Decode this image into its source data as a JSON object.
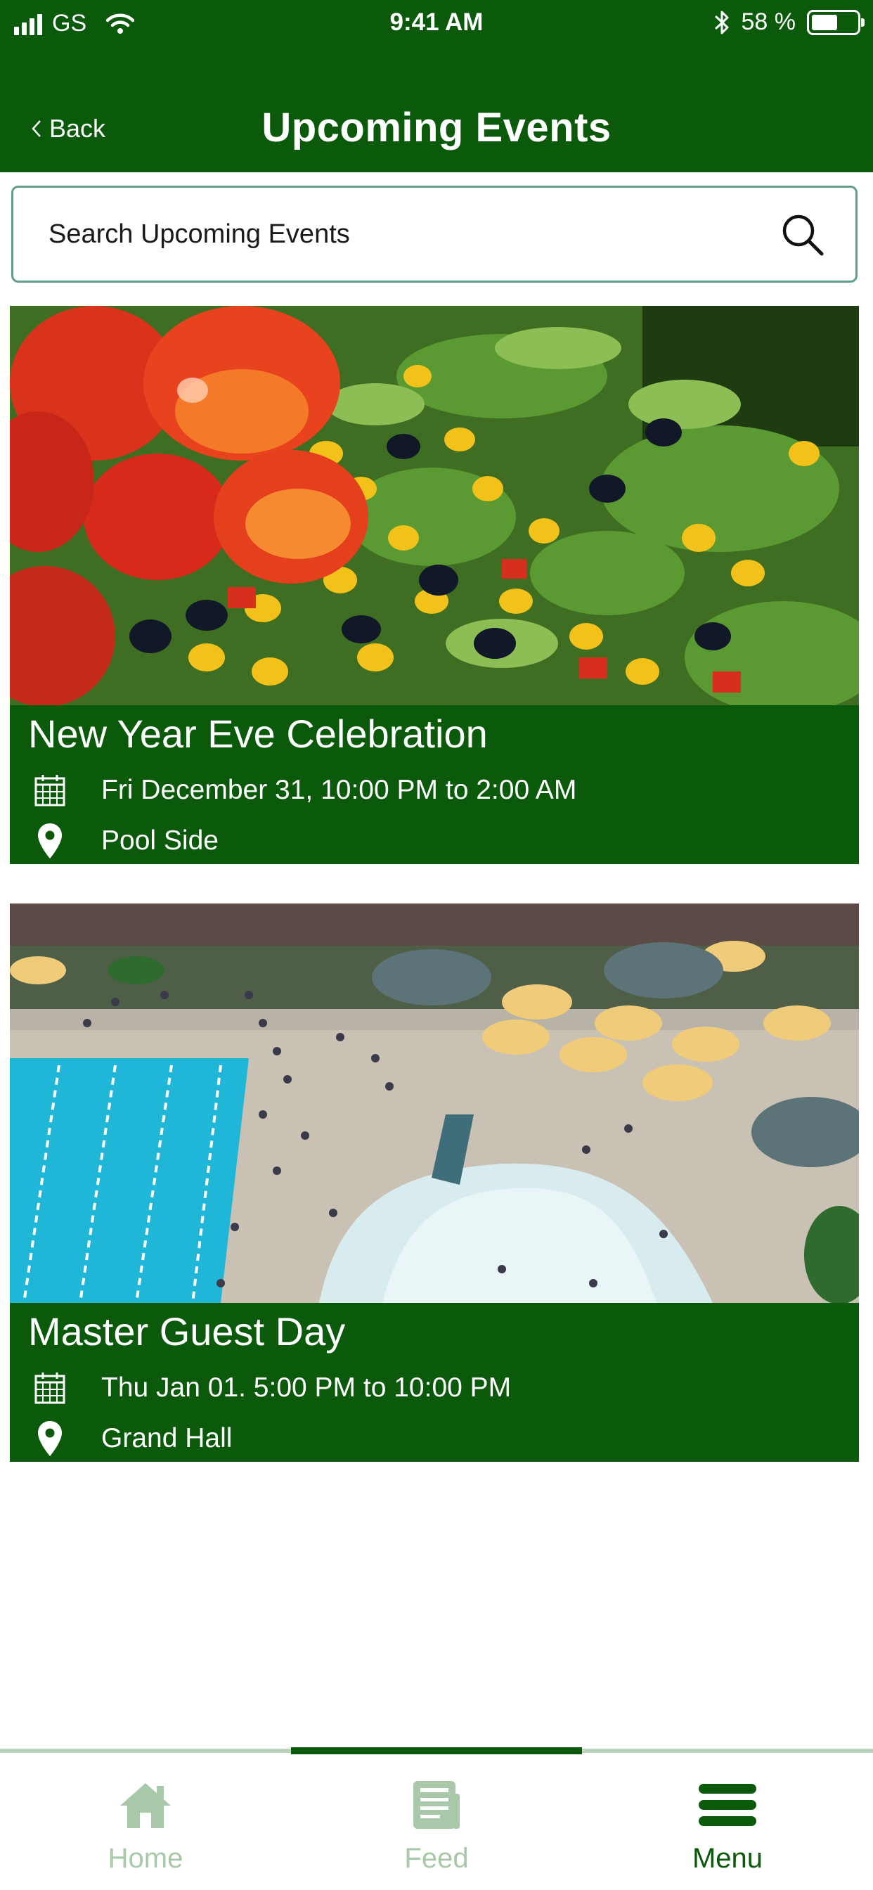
{
  "status_bar": {
    "carrier": "GS",
    "time": "9:41 AM",
    "battery": "58 %",
    "battery_level": 0.58
  },
  "header": {
    "back_label": "Back",
    "title": "Upcoming Events"
  },
  "search": {
    "placeholder": "Search Upcoming Events"
  },
  "events": [
    {
      "title": "New Year Eve Celebration",
      "date": "Fri December 31, 10:00 PM to 2:00 AM",
      "location": "Pool Side"
    },
    {
      "title": "Master Guest Day",
      "date": "Thu Jan 01. 5:00 PM to 10:00 PM",
      "location": "Grand Hall"
    }
  ],
  "tab_bar": {
    "tabs": [
      {
        "label": "Home"
      },
      {
        "label": "Feed"
      },
      {
        "label": "Menu"
      }
    ],
    "active_index": 2
  },
  "colors": {
    "brand_green": "#0b5a0b",
    "inactive_tab": "#a9c8a9"
  }
}
